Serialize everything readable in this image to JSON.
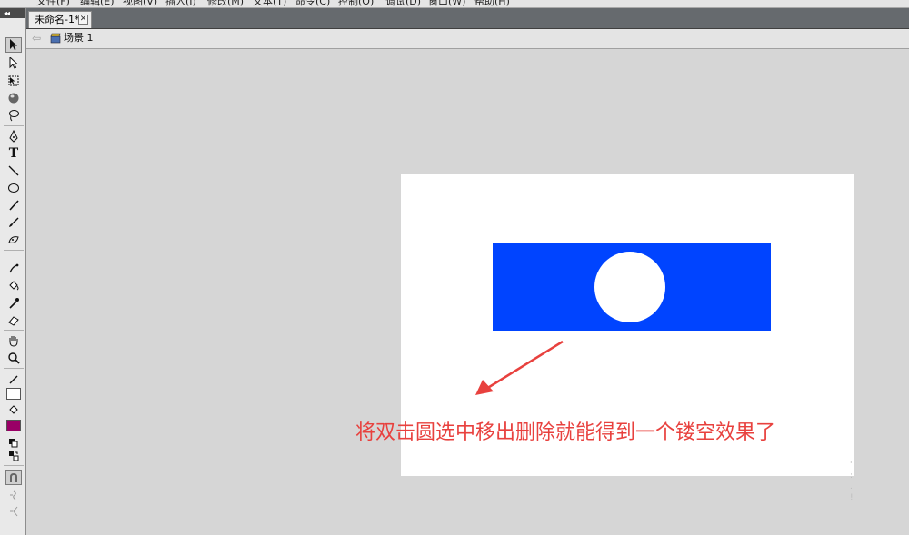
{
  "menubar": {
    "items": [
      "文件(F)",
      "编辑(E)",
      "视图(V)",
      "插入(I)",
      "修改(M)",
      "文本(T)",
      "命令(C)",
      "控制(O)",
      "调试(D)",
      "窗口(W)",
      "帮助(H)"
    ]
  },
  "toolbox": {
    "collapse_label": "◂◂",
    "tools": [
      {
        "name": "selection-tool"
      },
      {
        "name": "subselection-tool"
      },
      {
        "name": "free-transform-tool"
      },
      {
        "name": "3d-rotation-tool"
      },
      {
        "name": "lasso-tool"
      },
      {
        "name": "pen-tool"
      },
      {
        "name": "text-tool",
        "glyph": "T"
      },
      {
        "name": "line-tool"
      },
      {
        "name": "oval-tool"
      },
      {
        "name": "pencil-tool"
      },
      {
        "name": "brush-tool"
      },
      {
        "name": "deco-tool"
      },
      {
        "name": "bone-tool"
      },
      {
        "name": "paint-bucket-tool"
      },
      {
        "name": "eyedropper-tool"
      },
      {
        "name": "eraser-tool"
      },
      {
        "name": "hand-tool"
      },
      {
        "name": "zoom-tool"
      }
    ],
    "stroke_color": "#ffffff",
    "fill_color": "#990066"
  },
  "document_tab": {
    "title": "未命名-1*",
    "close_glyph": "✕"
  },
  "editbar": {
    "back_glyph": "⇦",
    "scene_label": "场景 1"
  },
  "stage": {
    "background": "#ffffff",
    "rect_color": "#0044ff",
    "hole_color": "#ffffff"
  },
  "annotation": {
    "text": "将双击圆选中移出删除就能得到一个镂空效果了",
    "color": "#e8413e"
  }
}
